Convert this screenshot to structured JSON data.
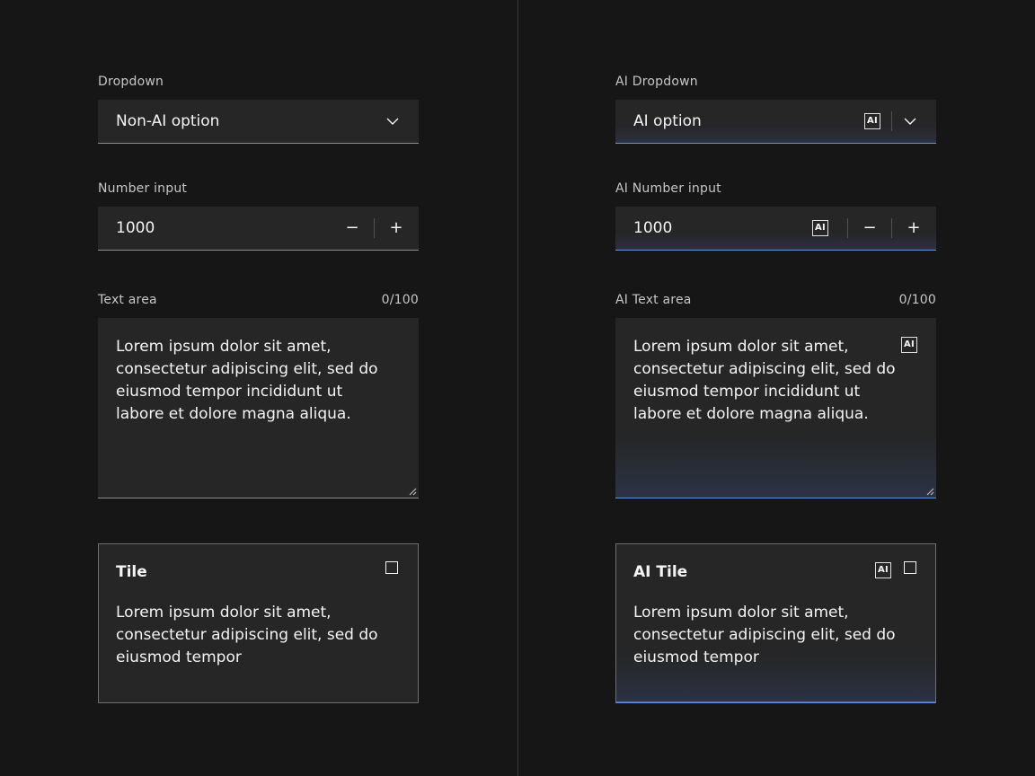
{
  "left": {
    "dropdown": {
      "label": "Dropdown",
      "value": "Non-AI option",
      "icon": "chevron-down-icon"
    },
    "number_input": {
      "label": "Number input",
      "value": "1000",
      "decrement": "−",
      "increment": "+"
    },
    "text_area": {
      "label": "Text area",
      "counter": "0/100",
      "lines": [
        "Lorem ipsum dolor sit amet,",
        "consectetur adipiscing elit, sed do",
        "eiusmod tempor incididunt ut",
        "labore et dolore magna aliqua."
      ]
    },
    "tile": {
      "title": "Tile",
      "lines": [
        "Lorem ipsum dolor sit amet,",
        "consectetur adipiscing elit, sed do",
        "eiusmod tempor"
      ]
    }
  },
  "right": {
    "dropdown": {
      "label": "AI Dropdown",
      "value": "AI option",
      "ai_badge": "AI",
      "icon": "chevron-down-icon"
    },
    "number_input": {
      "label": "AI Number input",
      "value": "1000",
      "ai_badge": "AI",
      "decrement": "−",
      "increment": "+"
    },
    "text_area": {
      "label": "AI Text area",
      "counter": "0/100",
      "ai_badge": "AI",
      "lines": [
        "Lorem ipsum dolor sit amet,",
        "consectetur adipiscing elit, sed do",
        "eiusmod tempor incididunt ut",
        "labore et dolore magna aliqua."
      ]
    },
    "tile": {
      "title": "AI Tile",
      "ai_badge": "AI",
      "lines": [
        "Lorem ipsum dolor sit amet,",
        "consectetur adipiscing elit, sed do",
        "eiusmod tempor"
      ]
    }
  },
  "colors": {
    "background": "#161616",
    "field": "#262626",
    "ai_accent": "#6d8fde",
    "divider": "#393939"
  }
}
